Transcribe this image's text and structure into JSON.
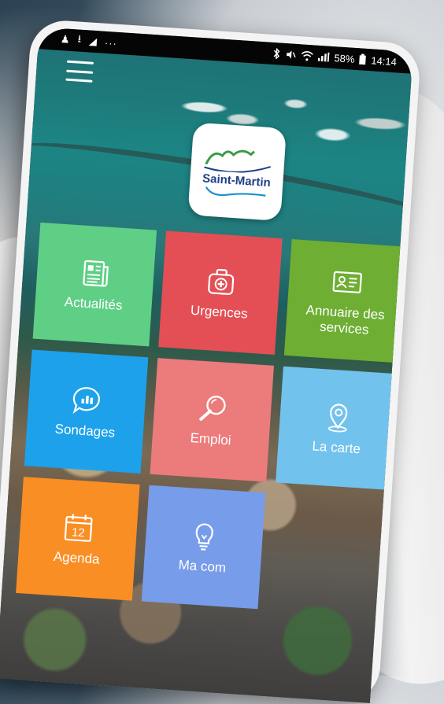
{
  "status_bar": {
    "left_icons": [
      "♟",
      "⭳",
      "◢",
      "···"
    ],
    "right_text": "58%",
    "time": "14:14"
  },
  "logo": {
    "title": "Saint-Martin"
  },
  "tiles": [
    {
      "label": "Actualités",
      "icon": "newspaper-icon",
      "color": "#5fcf86"
    },
    {
      "label": "Urgences",
      "icon": "first-aid-icon",
      "color": "#e34f55"
    },
    {
      "label": "Annuaire des services",
      "icon": "id-card-icon",
      "color": "#6eae33"
    },
    {
      "label": "Sondages",
      "icon": "chat-chart-icon",
      "color": "#1da1ea"
    },
    {
      "label": "Emploi",
      "icon": "magnifier-icon",
      "color": "#ec7b7c"
    },
    {
      "label": "La carte",
      "icon": "map-pin-icon",
      "color": "#72c2ee"
    },
    {
      "label": "Agenda",
      "icon": "calendar-icon",
      "color": "#f98e24",
      "calendar_day": "12"
    },
    {
      "label": "Ma com",
      "icon": "lightbulb-icon",
      "color": "#779ce9"
    }
  ]
}
